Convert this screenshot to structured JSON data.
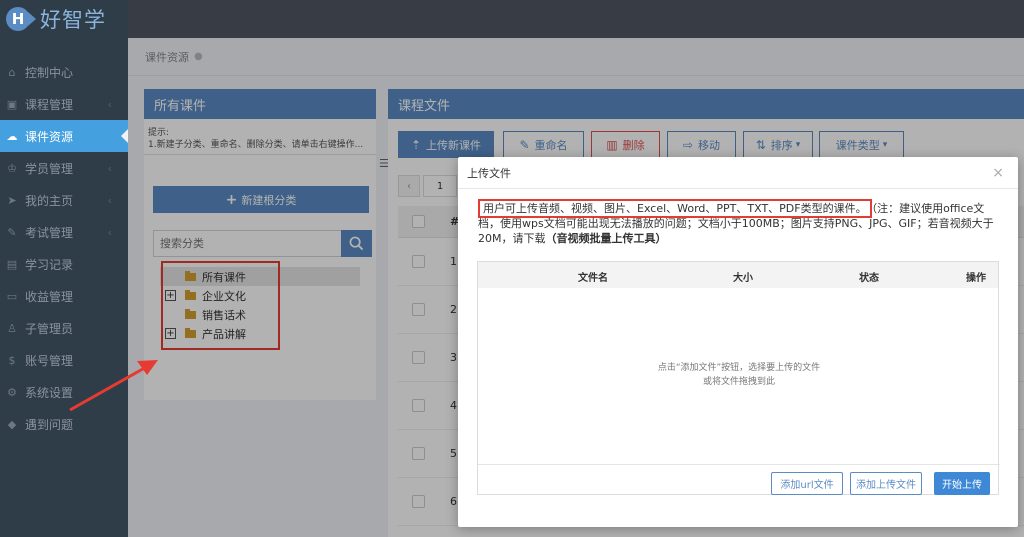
{
  "app": {
    "logo_letter": "H",
    "name": "好智学"
  },
  "sidebar": {
    "items": [
      {
        "label": "控制中心",
        "icon": "home-icon",
        "glyph": "⌂",
        "has_chevron": false
      },
      {
        "label": "课程管理",
        "icon": "course-icon",
        "glyph": "▣",
        "has_chevron": true
      },
      {
        "label": "课件资源",
        "icon": "cloud-icon",
        "glyph": "☁",
        "has_chevron": false,
        "active": true
      },
      {
        "label": "学员管理",
        "icon": "graduation-icon",
        "glyph": "♔",
        "has_chevron": true
      },
      {
        "label": "我的主页",
        "icon": "send-icon",
        "glyph": "➤",
        "has_chevron": true
      },
      {
        "label": "考试管理",
        "icon": "pencil-icon",
        "glyph": "✎",
        "has_chevron": true
      },
      {
        "label": "学习记录",
        "icon": "clipboard-icon",
        "glyph": "▤",
        "has_chevron": false
      },
      {
        "label": "收益管理",
        "icon": "card-icon",
        "glyph": "▭",
        "has_chevron": false
      },
      {
        "label": "子管理员",
        "icon": "user-icon",
        "glyph": "♙",
        "has_chevron": false
      },
      {
        "label": "账号管理",
        "icon": "dollar-icon",
        "glyph": "$",
        "has_chevron": false
      },
      {
        "label": "系统设置",
        "icon": "gear-icon",
        "glyph": "⚙",
        "has_chevron": false
      },
      {
        "label": "遇到问题",
        "icon": "question-icon",
        "glyph": "◆",
        "has_chevron": false
      }
    ]
  },
  "breadcrumb": {
    "label": "课件资源",
    "dot": "●"
  },
  "left_panel": {
    "title": "所有课件",
    "hint_title": "提示:",
    "hint_text": "1.新建子分类、重命名、删除分类、请单击右键操作...",
    "collapse_glyph": "☰",
    "new_root_label": "新建根分类",
    "search_placeholder": "搜索分类",
    "tree": [
      {
        "label": "所有课件",
        "toggle": "",
        "selected": true
      },
      {
        "label": "企业文化",
        "toggle": "+"
      },
      {
        "label": "销售话术",
        "toggle": ""
      },
      {
        "label": "产品讲解",
        "toggle": "+"
      }
    ]
  },
  "right_panel": {
    "title": "课程文件",
    "toolbar": {
      "upload": "上传新课件",
      "rename": "重命名",
      "delete": "删除",
      "move": "移动",
      "sort": "排序",
      "type": "课件类型"
    },
    "pager": {
      "prev": "‹",
      "page": "1"
    },
    "grid_header_num": "#",
    "rows": [
      "1",
      "2",
      "3",
      "4",
      "5",
      "6"
    ]
  },
  "modal": {
    "title": "上传文件",
    "close": "×",
    "notice_highlight": "用户可上传音频、视频、图片、Excel、Word、PPT、TXT、PDF类型的课件。",
    "notice_rest": "（注：建议使用office文档，使用wps文档可能出现无法播放的问题；文档小于100MB；图片支持PNG、JPG、GIF；若音视频大于20M，请下载",
    "notice_link": "（音视频批量上传工具）",
    "columns": {
      "name": "文件名",
      "size": "大小",
      "status": "状态",
      "action": "操作"
    },
    "drop_line1": "点击“添加文件”按钮，选择要上传的文件",
    "drop_line2": "或将文件拖拽到此",
    "buttons": {
      "add_url": "添加url文件",
      "add_upload": "添加上传文件",
      "start": "开始上传"
    }
  },
  "colors": {
    "accent": "#5b8cc4",
    "sidebar_bg": "#2f3d48",
    "active": "#45a0e0",
    "annotation": "#e53b32"
  }
}
